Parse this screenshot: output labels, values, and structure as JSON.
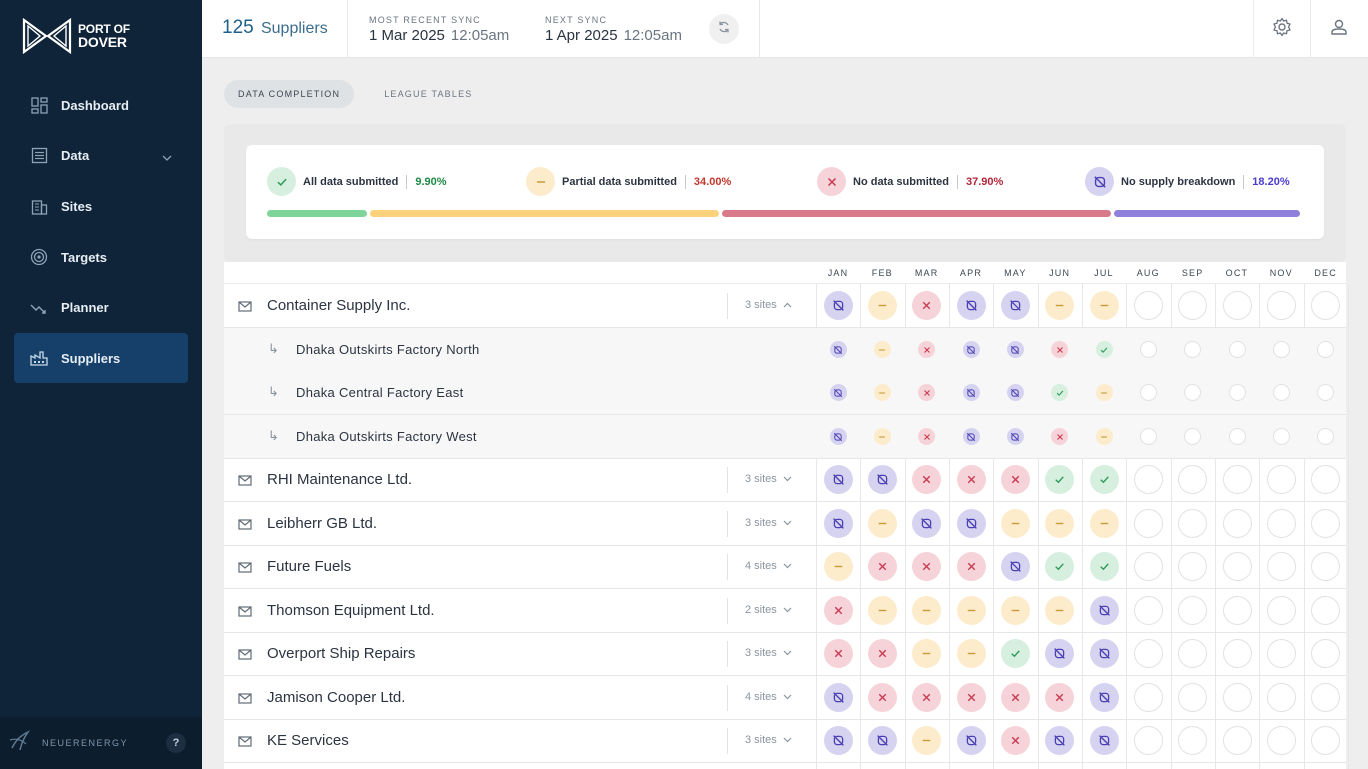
{
  "app": {
    "logo_line1": "PORT OF",
    "logo_line2": "DOVER",
    "footer_brand": "NEUERENERGY",
    "help": "?"
  },
  "sidebar": {
    "items": [
      {
        "label": "Dashboard",
        "icon": "dashboard-icon"
      },
      {
        "label": "Data",
        "icon": "data-icon"
      },
      {
        "label": "Sites",
        "icon": "sites-icon"
      },
      {
        "label": "Targets",
        "icon": "targets-icon"
      },
      {
        "label": "Planner",
        "icon": "planner-icon"
      },
      {
        "label": "Suppliers",
        "icon": "suppliers-icon",
        "active": true
      }
    ]
  },
  "header": {
    "supplier_count": "125",
    "supplier_label": "Suppliers",
    "recent_sync_label": "MOST RECENT SYNC",
    "recent_sync_date": "1 Mar 2025",
    "recent_sync_time": "12:05am",
    "next_sync_label": "NEXT SYNC",
    "next_sync_date": "1 Apr 2025",
    "next_sync_time": "12:05am"
  },
  "tabs": [
    "DATA COMPLETION",
    "LEAGUE TABLES"
  ],
  "summary": {
    "items": [
      {
        "label": "All data submitted",
        "pct": "9.90%",
        "status": "full",
        "color": "#1f8a45"
      },
      {
        "label": "Partial data submitted",
        "pct": "34.00%",
        "status": "partial",
        "color": "#c0392b"
      },
      {
        "label": "No data submitted",
        "pct": "37.90%",
        "status": "none",
        "color": "#b3263a"
      },
      {
        "label": "No supply breakdown",
        "pct": "18.20%",
        "status": "breakdown",
        "color": "#4a3bd1"
      }
    ],
    "bar_colors": [
      "#7fd49a",
      "#fdd27c",
      "#d97a8a",
      "#8f80dc"
    ],
    "bar_fractions": [
      0.099,
      0.34,
      0.379,
      0.182
    ]
  },
  "months": [
    "JAN",
    "FEB",
    "MAR",
    "APR",
    "MAY",
    "JUN",
    "JUL",
    "AUG",
    "SEP",
    "OCT",
    "NOV",
    "DEC"
  ],
  "rows": [
    {
      "name": "Container Supply Inc.",
      "sites": "3 sites",
      "expanded": true,
      "status": [
        "breakdown",
        "partial",
        "none",
        "breakdown",
        "breakdown",
        "partial",
        "partial",
        "empty",
        "empty",
        "empty",
        "empty",
        "empty"
      ]
    },
    {
      "name": "Dhaka Outskirts Factory North",
      "sub": true,
      "status": [
        "breakdown",
        "partial",
        "none",
        "breakdown",
        "breakdown",
        "none",
        "full",
        "empty",
        "empty",
        "empty",
        "empty",
        "empty"
      ]
    },
    {
      "name": "Dhaka Central Factory East",
      "sub": true,
      "status": [
        "breakdown",
        "partial",
        "none",
        "breakdown",
        "breakdown",
        "full",
        "partial",
        "empty",
        "empty",
        "empty",
        "empty",
        "empty"
      ]
    },
    {
      "name": "Dhaka Outskirts Factory West",
      "sub": true,
      "status": [
        "breakdown",
        "partial",
        "none",
        "breakdown",
        "breakdown",
        "none",
        "partial",
        "empty",
        "empty",
        "empty",
        "empty",
        "empty"
      ]
    },
    {
      "name": "RHI Maintenance Ltd.",
      "sites": "3 sites",
      "status": [
        "breakdown",
        "breakdown",
        "none",
        "none",
        "none",
        "full",
        "full",
        "empty",
        "empty",
        "empty",
        "empty",
        "empty"
      ]
    },
    {
      "name": "Leibherr GB Ltd.",
      "sites": "3 sites",
      "status": [
        "breakdown",
        "partial",
        "breakdown",
        "breakdown",
        "partial",
        "partial",
        "partial",
        "empty",
        "empty",
        "empty",
        "empty",
        "empty"
      ]
    },
    {
      "name": "Future Fuels",
      "sites": "4 sites",
      "status": [
        "partial",
        "none",
        "none",
        "none",
        "breakdown",
        "full",
        "full",
        "empty",
        "empty",
        "empty",
        "empty",
        "empty"
      ]
    },
    {
      "name": "Thomson Equipment Ltd.",
      "sites": "2 sites",
      "status": [
        "none",
        "partial",
        "partial",
        "partial",
        "partial",
        "partial",
        "breakdown",
        "empty",
        "empty",
        "empty",
        "empty",
        "empty"
      ]
    },
    {
      "name": "Overport Ship Repairs",
      "sites": "3 sites",
      "status": [
        "none",
        "none",
        "partial",
        "partial",
        "full",
        "breakdown",
        "breakdown",
        "empty",
        "empty",
        "empty",
        "empty",
        "empty"
      ]
    },
    {
      "name": "Jamison Cooper Ltd.",
      "sites": "4 sites",
      "status": [
        "breakdown",
        "none",
        "none",
        "none",
        "none",
        "none",
        "breakdown",
        "empty",
        "empty",
        "empty",
        "empty",
        "empty"
      ]
    },
    {
      "name": "KE Services",
      "sites": "3 sites",
      "status": [
        "breakdown",
        "breakdown",
        "partial",
        "breakdown",
        "none",
        "breakdown",
        "breakdown",
        "empty",
        "empty",
        "empty",
        "empty",
        "empty"
      ]
    }
  ]
}
